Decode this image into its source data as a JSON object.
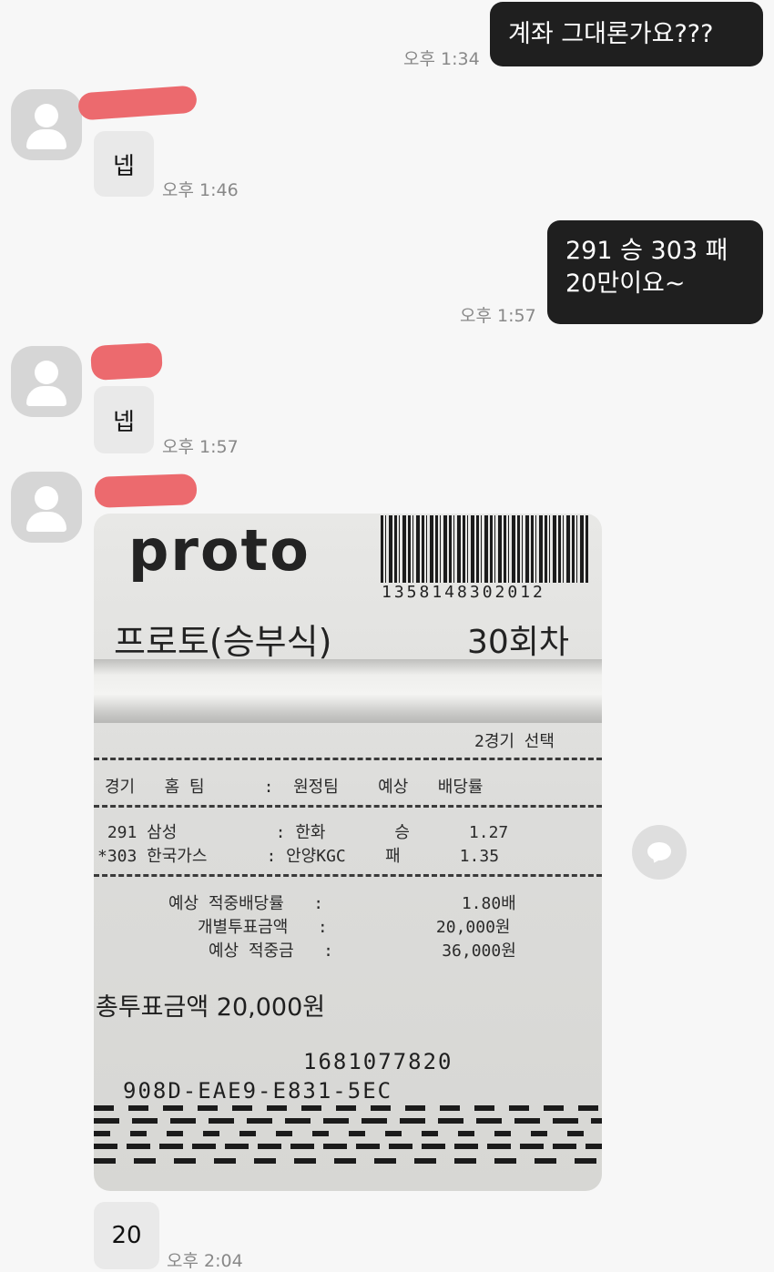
{
  "messages": {
    "m1": {
      "text": "계좌 그대론가요???",
      "time": "오후 1:34"
    },
    "m2": {
      "text": "넵",
      "time": "오후 1:46"
    },
    "m3": {
      "line1": "291 승 303 패",
      "line2": "20만이요~",
      "time": "오후 1:57"
    },
    "m4": {
      "text": "넵",
      "time": "오후 1:57"
    },
    "m6": {
      "text": "20",
      "time": "오후 2:04"
    }
  },
  "receipt": {
    "logo": "proto",
    "barcode_number": "1358148302012",
    "title": "프로토(승부식)",
    "round": "30회차",
    "selection": "2경기 선택",
    "header": "경기   홈 팀      :  원정팀    예상   배당률",
    "row1": " 291 삼성          : 한화       승      1.27",
    "row2": "*303 한국가스      : 안양KGC    패      1.35",
    "sum1": "예상 적중배당률   :              1.80배",
    "sum2": "개별투표금액   :           20,000원",
    "sum3": "예상 적중금   :           36,000원",
    "total": "총투표금액 20,000원",
    "code1": "1681077820",
    "code2": "908D-EAE9-E831-5EC"
  }
}
